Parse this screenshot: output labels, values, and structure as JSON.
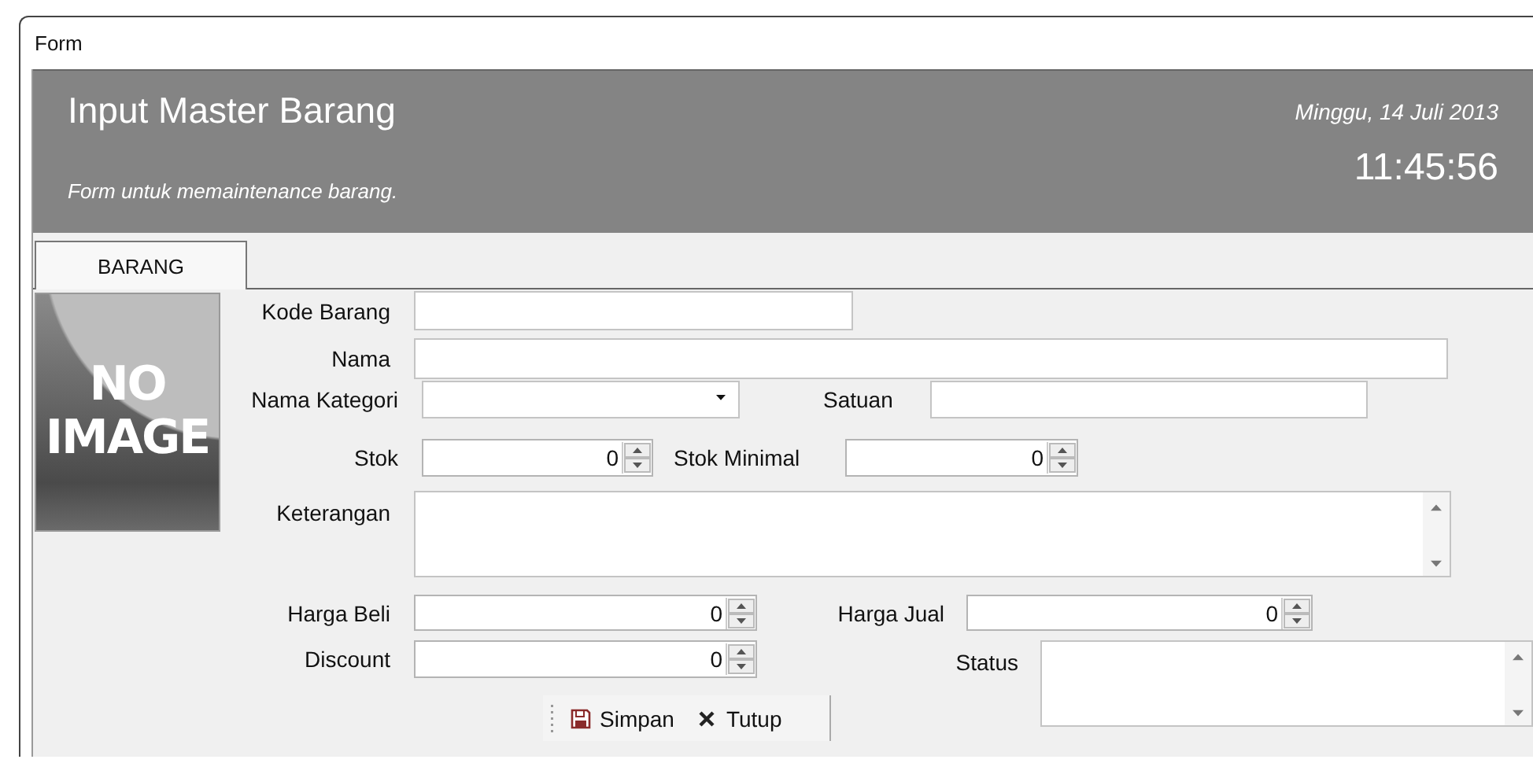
{
  "window": {
    "title": "Form"
  },
  "header": {
    "title": "Input Master Barang",
    "subtitle": "Form untuk memaintenance barang.",
    "date": "Minggu, 14 Juli 2013",
    "time": "11:45:56"
  },
  "tabs": [
    {
      "label": "BARANG",
      "selected": true
    }
  ],
  "no_image": {
    "line_1": "NO",
    "line_2": "IMAGE"
  },
  "form_rows": [
    {
      "fields": [
        {
          "kind": "text",
          "label": "Kode Barang"
        }
      ]
    },
    {
      "fields": [
        {
          "kind": "text",
          "label": "Nama"
        }
      ]
    },
    {
      "fields": [
        {
          "kind": "combo",
          "label": "Nama Kategori"
        },
        {
          "kind": "text",
          "label": "Satuan"
        }
      ]
    },
    {
      "fields": [
        {
          "kind": "spin",
          "label": "Stok",
          "value": "0"
        },
        {
          "kind": "spin",
          "label": "Stok Minimal",
          "value": "0"
        }
      ]
    },
    {
      "fields": [
        {
          "kind": "memo",
          "label": "Keterangan"
        }
      ]
    },
    {
      "fields": [
        {
          "kind": "spin",
          "label": "Harga Beli",
          "value": "0"
        },
        {
          "kind": "spin",
          "label": "Harga Jual",
          "value": "0"
        }
      ]
    },
    {
      "fields": [
        {
          "kind": "spin",
          "label": "Discount",
          "value": "0"
        },
        {
          "kind": "memo",
          "label": "Status"
        }
      ]
    }
  ],
  "buttons": [
    {
      "kind": "save",
      "label": "Simpan"
    },
    {
      "kind": "close",
      "label": "Tutup"
    }
  ]
}
